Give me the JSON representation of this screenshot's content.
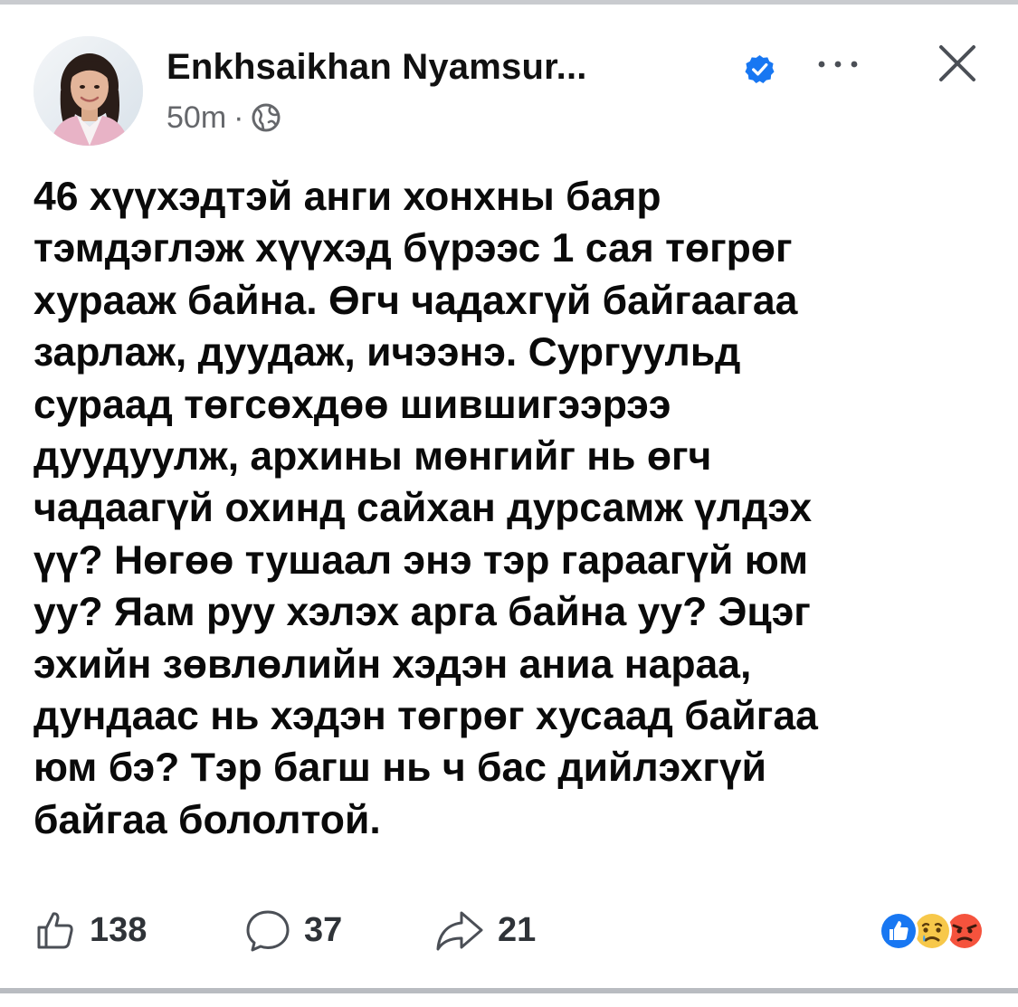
{
  "post": {
    "author": "Enkhsaikhan Nyamsur...",
    "time": "50m",
    "separator": "·",
    "lines": [
      "46 хүүхэдтэй анги хонхны баяр",
      "тэмдэглэж хүүхэд бүрээс 1 сая төгрөг",
      "хурааж байна. Өгч чадахгүй байгаагаа",
      "зарлаж, дуудаж, ичээнэ. Сургуульд",
      "сураад төгсөхдөө шившигээрээ",
      "дуудуулж, архины мөнгийг нь өгч",
      "чадаагүй охинд сайхан дурсамж үлдэх",
      "үү? Нөгөө тушаал энэ тэр гараагүй юм",
      "уу? Яам руу хэлэх арга байна уу? Эцэг",
      "эхийн зөвлөлийн хэдэн аниа нараа,",
      "дундаас нь хэдэн төгрөг хусаад байгаа",
      "юм бэ? Тэр багш нь ч бас дийлэхгүй",
      "байгаа бололтой."
    ]
  },
  "actions": {
    "likes": "138",
    "comments": "37",
    "shares": "21"
  },
  "icons": {
    "verified": "verified-badge-icon",
    "more": "more-dots-icon",
    "close": "close-icon",
    "audience": "globe-icon",
    "like": "thumbs-up-icon",
    "comment": "comment-bubble-icon",
    "share": "share-arrow-icon",
    "reactions": [
      "like-reaction-icon",
      "sad-reaction-icon",
      "angry-reaction-icon"
    ]
  },
  "colors": {
    "verified": "#1877f2",
    "meta_text": "#65676b",
    "divider": "#c9cbcf"
  }
}
